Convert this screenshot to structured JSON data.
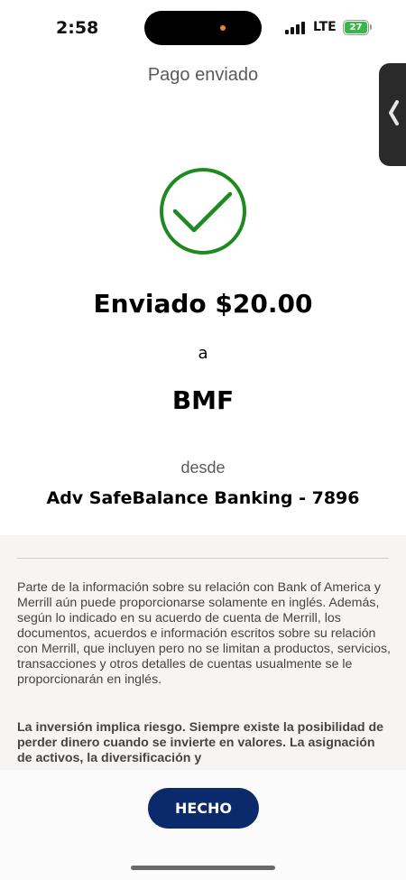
{
  "status_bar": {
    "time": "2:58",
    "network": "LTE",
    "battery_level": "27",
    "battery_color": "#39b54a"
  },
  "header": {
    "title": "Pago enviado"
  },
  "confirmation": {
    "icon": "checkmark-circle-icon",
    "icon_color": "#1f8a1f",
    "sent_amount": "Enviado $20.00",
    "to_label": "a",
    "recipient": "BMF",
    "from_label": "desde",
    "from_account": "Adv SafeBalance Banking - 7896"
  },
  "disclosure": {
    "text": "Parte de la información sobre su relación con Bank of America y Merrill aún puede proporcionarse solamente en inglés. Además, según lo indicado en su acuerdo de cuenta de Merrill, los documentos, acuerdos e información escritos sobre su relación con Merrill, que incluyen pero no se limitan a productos, servicios, transacciones y otros detalles de cuentas usualmente se le proporcionarán en inglés.",
    "bold_text": "La inversión implica riesgo. Siempre existe la posibilidad de perder dinero cuando se invierte en valores. La asignación de activos, la diversificación y"
  },
  "footer": {
    "done_label": "HECHO",
    "done_color": "#0b2a6b"
  }
}
